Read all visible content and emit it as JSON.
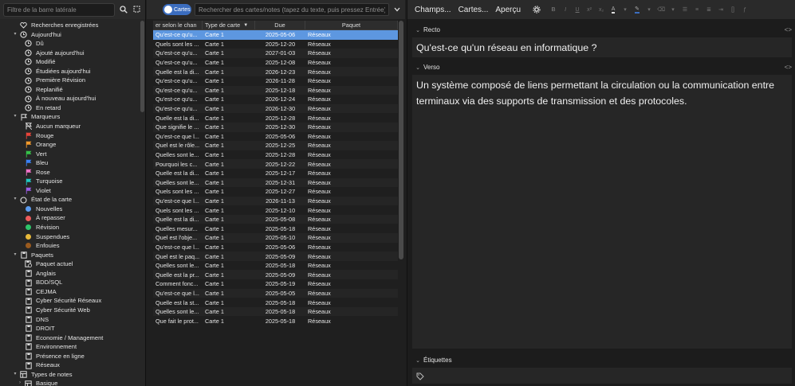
{
  "sidebar": {
    "filter_placeholder": "Filtre de la barre latérale",
    "tree": [
      {
        "label": "Recherches enregistrées",
        "depth": 0,
        "icon": "heart-icon",
        "twisty": ""
      },
      {
        "label": "Aujourd'hui",
        "depth": 0,
        "icon": "clock-icon",
        "twisty": "v"
      },
      {
        "label": "Dû",
        "depth": 1,
        "icon": "clock-icon",
        "twisty": ""
      },
      {
        "label": "Ajouté aujourd'hui",
        "depth": 1,
        "icon": "clock-icon",
        "twisty": ""
      },
      {
        "label": "Modifié",
        "depth": 1,
        "icon": "clock-icon",
        "twisty": ""
      },
      {
        "label": "Étudiées aujourd'hui",
        "depth": 1,
        "icon": "clock-icon",
        "twisty": ""
      },
      {
        "label": "Première Révision",
        "depth": 1,
        "icon": "clock-icon",
        "twisty": ""
      },
      {
        "label": "Replanifié",
        "depth": 1,
        "icon": "clock-icon",
        "twisty": ""
      },
      {
        "label": "À nouveau aujourd'hui",
        "depth": 1,
        "icon": "clock-icon",
        "twisty": ""
      },
      {
        "label": "En retard",
        "depth": 1,
        "icon": "clock-icon",
        "twisty": ""
      },
      {
        "label": "Marqueurs",
        "depth": 0,
        "icon": "flag-outline-icon",
        "twisty": "v"
      },
      {
        "label": "Aucun marqueur",
        "depth": 1,
        "icon": "no-flag-icon",
        "twisty": ""
      },
      {
        "label": "Rouge",
        "depth": 1,
        "icon": "flag-icon",
        "color": "#e8443a",
        "twisty": ""
      },
      {
        "label": "Orange",
        "depth": 1,
        "icon": "flag-icon",
        "color": "#f39a2c",
        "twisty": ""
      },
      {
        "label": "Vert",
        "depth": 1,
        "icon": "flag-icon",
        "color": "#35c24a",
        "twisty": ""
      },
      {
        "label": "Bleu",
        "depth": 1,
        "icon": "flag-icon",
        "color": "#3b82f6",
        "twisty": ""
      },
      {
        "label": "Rose",
        "depth": 1,
        "icon": "flag-icon",
        "color": "#f072c8",
        "twisty": ""
      },
      {
        "label": "Turquoise",
        "depth": 1,
        "icon": "flag-icon",
        "color": "#22c7c2",
        "twisty": ""
      },
      {
        "label": "Violet",
        "depth": 1,
        "icon": "flag-icon",
        "color": "#9b5de5",
        "twisty": ""
      },
      {
        "label": "État de la carte",
        "depth": 0,
        "icon": "circle-outline-icon",
        "twisty": "v"
      },
      {
        "label": "Nouvelles",
        "depth": 1,
        "icon": "dot-icon",
        "color": "#5b9cf0",
        "twisty": ""
      },
      {
        "label": "À repasser",
        "depth": 1,
        "icon": "dot-icon",
        "color": "#ee5b5b",
        "twisty": ""
      },
      {
        "label": "Révision",
        "depth": 1,
        "icon": "dot-icon",
        "color": "#2ec46a",
        "twisty": ""
      },
      {
        "label": "Suspendues",
        "depth": 1,
        "icon": "dot-icon",
        "color": "#e7b93a",
        "twisty": ""
      },
      {
        "label": "Enfouies",
        "depth": 1,
        "icon": "dot-icon",
        "color": "#9a5a1e",
        "twisty": ""
      },
      {
        "label": "Paquets",
        "depth": 0,
        "icon": "deck-icon",
        "twisty": "v"
      },
      {
        "label": "Paquet actuel",
        "depth": 1,
        "icon": "current-deck-icon",
        "twisty": ""
      },
      {
        "label": "Anglais",
        "depth": 1,
        "icon": "deck-icon",
        "twisty": ""
      },
      {
        "label": "BDD/SQL",
        "depth": 1,
        "icon": "deck-icon",
        "twisty": ""
      },
      {
        "label": "CEJMA",
        "depth": 1,
        "icon": "deck-icon",
        "twisty": ""
      },
      {
        "label": "Cyber Sécurité Réseaux",
        "depth": 1,
        "icon": "deck-icon",
        "twisty": ""
      },
      {
        "label": "Cyber Sécurité Web",
        "depth": 1,
        "icon": "deck-icon",
        "twisty": ""
      },
      {
        "label": "DNS",
        "depth": 1,
        "icon": "deck-icon",
        "twisty": ""
      },
      {
        "label": "DROIT",
        "depth": 1,
        "icon": "deck-icon",
        "twisty": ""
      },
      {
        "label": "Economie / Management",
        "depth": 1,
        "icon": "deck-icon",
        "twisty": ""
      },
      {
        "label": "Environnement",
        "depth": 1,
        "icon": "deck-icon",
        "twisty": ""
      },
      {
        "label": "Présence en ligne",
        "depth": 1,
        "icon": "deck-icon",
        "twisty": ""
      },
      {
        "label": "Réseaux",
        "depth": 1,
        "icon": "deck-icon",
        "twisty": ""
      },
      {
        "label": "Types de notes",
        "depth": 0,
        "icon": "notetype-icon",
        "twisty": "v"
      },
      {
        "label": "Basique",
        "depth": 1,
        "icon": "notetype-icon",
        "twisty": ">"
      }
    ]
  },
  "browser": {
    "toggle_label": "Cartes",
    "search_placeholder": "Rechercher des cartes/notes (tapez du texte, puis pressez Entrée)",
    "columns": [
      "er selon le chan",
      "Type de carte",
      "Due",
      "Paquet"
    ],
    "sort_indicator": "▼",
    "rows": [
      [
        "Qu'est-ce qu'u...",
        "Carte 1",
        "2025-05-06",
        "Réseaux"
      ],
      [
        "Quels sont les ...",
        "Carte 1",
        "2025-12-20",
        "Réseaux"
      ],
      [
        "Qu'est-ce qu'u...",
        "Carte 1",
        "2027-01-03",
        "Réseaux"
      ],
      [
        "Qu'est-ce qu'u...",
        "Carte 1",
        "2025-12-08",
        "Réseaux"
      ],
      [
        "Quelle est la di...",
        "Carte 1",
        "2026-12-23",
        "Réseaux"
      ],
      [
        "Qu'est-ce qu'u...",
        "Carte 1",
        "2026-11-28",
        "Réseaux"
      ],
      [
        "Qu'est-ce qu'u...",
        "Carte 1",
        "2025-12-18",
        "Réseaux"
      ],
      [
        "Qu'est-ce qu'u...",
        "Carte 1",
        "2026-12-24",
        "Réseaux"
      ],
      [
        "Qu'est-ce qu'u...",
        "Carte 1",
        "2026-12-30",
        "Réseaux"
      ],
      [
        "Quelle est la di...",
        "Carte 1",
        "2025-12-28",
        "Réseaux"
      ],
      [
        "Que signifie le ...",
        "Carte 1",
        "2025-12-30",
        "Réseaux"
      ],
      [
        "Qu'est-ce que l...",
        "Carte 1",
        "2025-05-06",
        "Réseaux"
      ],
      [
        "Quel est le rôle...",
        "Carte 1",
        "2025-12-25",
        "Réseaux"
      ],
      [
        "Quelles sont le...",
        "Carte 1",
        "2025-12-28",
        "Réseaux"
      ],
      [
        "Pourquoi les c...",
        "Carte 1",
        "2025-12-22",
        "Réseaux"
      ],
      [
        "Quelle est la di...",
        "Carte 1",
        "2025-12-17",
        "Réseaux"
      ],
      [
        "Quelles sont le...",
        "Carte 1",
        "2025-12-31",
        "Réseaux"
      ],
      [
        "Quels sont les ...",
        "Carte 1",
        "2025-12-27",
        "Réseaux"
      ],
      [
        "Qu'est-ce que l...",
        "Carte 1",
        "2026-11-13",
        "Réseaux"
      ],
      [
        "Quels sont les ...",
        "Carte 1",
        "2025-12-10",
        "Réseaux"
      ],
      [
        "Quelle est la di...",
        "Carte 1",
        "2025-05-08",
        "Réseaux"
      ],
      [
        "Quelles mesur...",
        "Carte 1",
        "2025-05-18",
        "Réseaux"
      ],
      [
        "Quel est l'obje...",
        "Carte 1",
        "2025-05-10",
        "Réseaux"
      ],
      [
        "Qu'est-ce que l...",
        "Carte 1",
        "2025-05-06",
        "Réseaux"
      ],
      [
        "Quel est le paq...",
        "Carte 1",
        "2025-05-09",
        "Réseaux"
      ],
      [
        "Quelles sont le...",
        "Carte 1",
        "2025-05-18",
        "Réseaux"
      ],
      [
        "Quelle est la pr...",
        "Carte 1",
        "2025-05-09",
        "Réseaux"
      ],
      [
        "Comment fonc...",
        "Carte 1",
        "2025-05-19",
        "Réseaux"
      ],
      [
        "Qu'est-ce que l...",
        "Carte 1",
        "2025-05-05",
        "Réseaux"
      ],
      [
        "Quelle est la st...",
        "Carte 1",
        "2025-05-18",
        "Réseaux"
      ],
      [
        "Quelles sont le...",
        "Carte 1",
        "2025-05-18",
        "Réseaux"
      ],
      [
        "Que fait le prot...",
        "Carte 1",
        "2025-05-18",
        "Réseaux"
      ]
    ],
    "selected_row": 0
  },
  "editor": {
    "fields_btn": "Champs...",
    "cards_btn": "Cartes...",
    "preview_btn": "Aperçu",
    "front_label": "Recto",
    "front_text": "Qu'est-ce qu'un réseau en informatique ?",
    "back_label": "Verso",
    "back_text": "Un système composé de liens permettant la circulation ou la communication entre terminaux via des supports de transmission et des protocoles.",
    "tags_label": "Étiquettes",
    "code_glyph": "<>"
  }
}
